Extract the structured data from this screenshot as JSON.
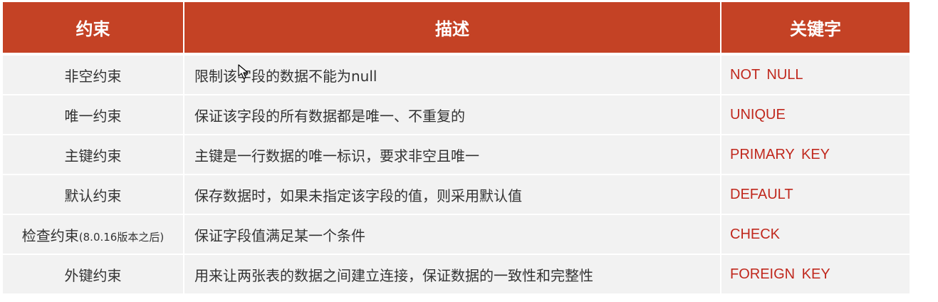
{
  "table": {
    "headers": [
      "约束",
      "描述",
      "关键字"
    ],
    "rows": [
      {
        "constraint": "非空约束",
        "note": "",
        "description": "限制该字段的数据不能为null",
        "keyword": "NOT  NULL"
      },
      {
        "constraint": "唯一约束",
        "note": "",
        "description": "保证该字段的所有数据都是唯一、不重复的",
        "keyword": "UNIQUE"
      },
      {
        "constraint": "主键约束",
        "note": "",
        "description": "主键是一行数据的唯一标识，要求非空且唯一",
        "keyword": "PRIMARY  KEY"
      },
      {
        "constraint": "默认约束",
        "note": "",
        "description": "保存数据时，如果未指定该字段的值，则采用默认值",
        "keyword": "DEFAULT"
      },
      {
        "constraint": "检查约束",
        "note": "(8.0.16版本之后)",
        "description": "保证字段值满足某一个条件",
        "keyword": "CHECK"
      },
      {
        "constraint": "外键约束",
        "note": "",
        "description": "用来让两张表的数据之间建立连接，保证数据的一致性和完整性",
        "keyword": "FOREIGN  KEY"
      }
    ]
  },
  "colors": {
    "header_bg": "#c44225",
    "header_text": "#ffffff",
    "row_bg": "#f2f2f2",
    "keyword_text": "#c0281d"
  },
  "icons": {
    "cursor": "mouse-pointer-icon"
  }
}
